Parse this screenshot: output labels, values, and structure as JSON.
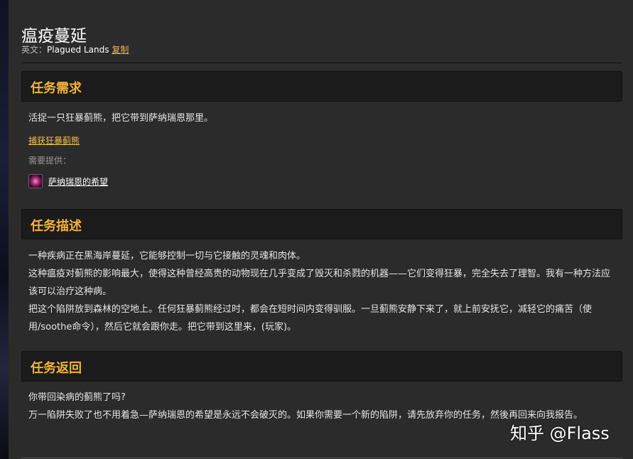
{
  "page": {
    "title": "瘟疫蔓延",
    "subtitle_prefix": "英文：",
    "english_name": "Plagued Lands",
    "copy_label": "复制"
  },
  "requirements": {
    "header": "任务需求",
    "objective": "活捉一只狂暴蓟熊，把它带到萨纳瑞恩那里。",
    "link": "捕获狂暴蓟熊",
    "provided_label": "需要提供：",
    "provided_item": "萨纳瑞恩的希望",
    "provided_icon": "pink-orb-icon"
  },
  "description": {
    "header": "任务描述",
    "paragraphs": [
      "一种疾病正在黑海岸蔓延，它能够控制一切与它接触的灵魂和肉体。",
      "这种瘟疫对蓟熊的影响最大，使得这种曾经高贵的动物现在几乎变成了毁灭和杀戮的机器——它们变得狂暴，完全失去了理智。我有一种方法应该可以治疗这种病。",
      "把这个陷阱放到森林的空地上。任何狂暴蓟熊经过时，都会在短时间内变得驯服。一旦蓟熊安静下来了，就上前安抚它，减轻它的痛苦（使用/soothe命令），然后它就会跟你走。把它带到这里来，(玩家)。"
    ]
  },
  "return": {
    "header": "任务返回",
    "paragraphs": [
      "你带回染病的蓟熊了吗?",
      "万一陷阱失败了也不用着急—萨纳瑞恩的希望是永远不会破灭的。如果你需要一个新的陷阱，请先放弃你的任务，然後再回来向我报告。"
    ]
  },
  "watermark": "知乎 @Flass"
}
